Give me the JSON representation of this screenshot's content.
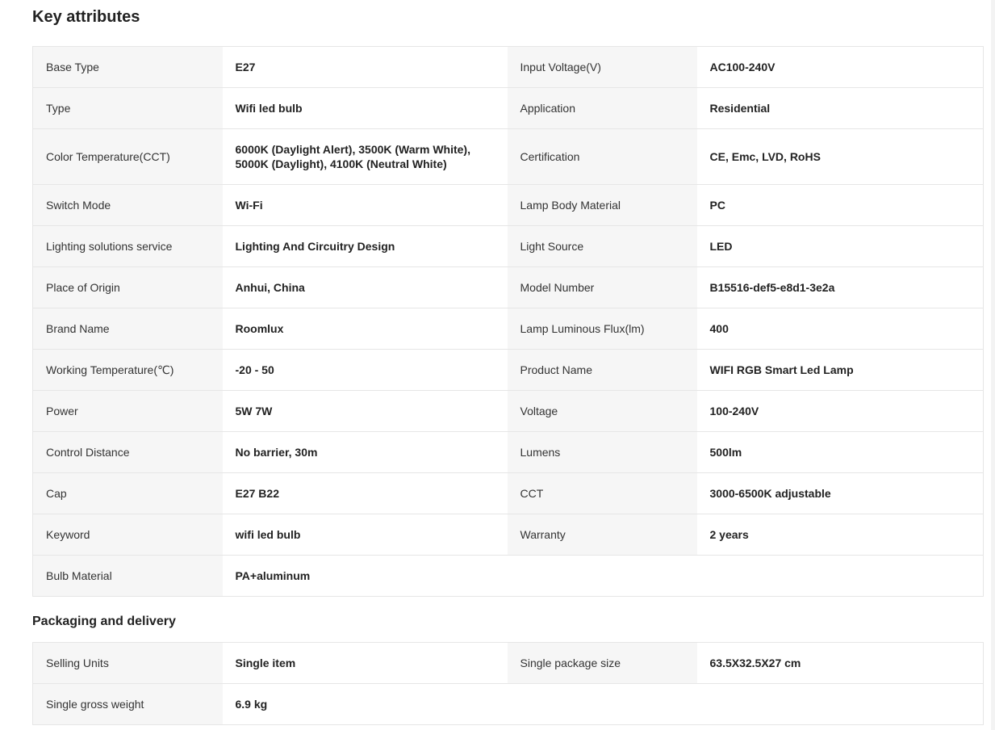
{
  "key_attributes": {
    "title": "Key attributes",
    "rows": [
      {
        "k1": "Base Type",
        "v1": "E27",
        "k2": "Input Voltage(V)",
        "v2": "AC100-240V"
      },
      {
        "k1": "Type",
        "v1": "Wifi led bulb",
        "k2": "Application",
        "v2": "Residential"
      },
      {
        "k1": "Color Temperature(CCT)",
        "v1": "6000K (Daylight Alert), 3500K (Warm White), 5000K (Daylight), 4100K (Neutral White)",
        "k2": "Certification",
        "v2": "CE, Emc, LVD, RoHS"
      },
      {
        "k1": "Switch Mode",
        "v1": "Wi-Fi",
        "k2": "Lamp Body Material",
        "v2": "PC"
      },
      {
        "k1": "Lighting solutions service",
        "v1": "Lighting And Circuitry Design",
        "k2": "Light Source",
        "v2": "LED"
      },
      {
        "k1": "Place of Origin",
        "v1": "Anhui, China",
        "k2": "Model Number",
        "v2": "B15516-def5-e8d1-3e2a"
      },
      {
        "k1": "Brand Name",
        "v1": "Roomlux",
        "k2": "Lamp Luminous Flux(lm)",
        "v2": "400"
      },
      {
        "k1": "Working Temperature(℃)",
        "v1": "-20 - 50",
        "k2": "Product Name",
        "v2": "WIFI RGB Smart Led Lamp"
      },
      {
        "k1": "Power",
        "v1": "5W 7W",
        "k2": "Voltage",
        "v2": "100-240V"
      },
      {
        "k1": "Control Distance",
        "v1": "No barrier, 30m",
        "k2": "Lumens",
        "v2": "500lm"
      },
      {
        "k1": "Cap",
        "v1": "E27 B22",
        "k2": "CCT",
        "v2": "3000-6500K adjustable"
      },
      {
        "k1": "Keyword",
        "v1": "wifi led bulb",
        "k2": "Warranty",
        "v2": "2 years"
      },
      {
        "k1": "Bulb Material",
        "v1": "PA+aluminum",
        "k2": "",
        "v2": ""
      }
    ]
  },
  "packaging": {
    "title": "Packaging and delivery",
    "rows": [
      {
        "k1": "Selling Units",
        "v1": "Single item",
        "k2": "Single package size",
        "v2": "63.5X32.5X27 cm"
      },
      {
        "k1": "Single gross weight",
        "v1": "6.9 kg",
        "k2": "",
        "v2": ""
      }
    ]
  }
}
